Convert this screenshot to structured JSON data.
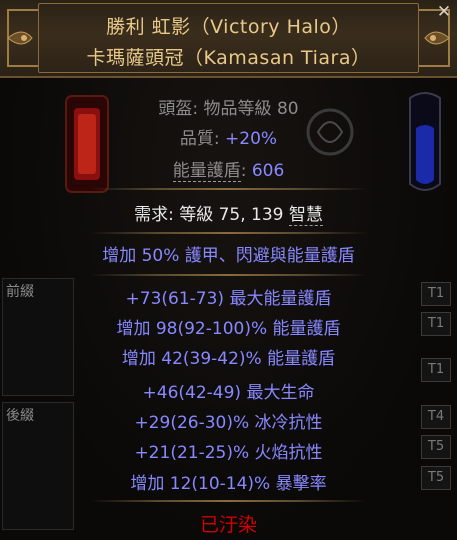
{
  "header": {
    "name": "勝利 虹影（Victory Halo）",
    "base_type": "卡瑪薩頭冠（Kamasan Tiara）"
  },
  "properties": {
    "type_line": "頭盔: 物品等級 80",
    "quality_label": "品質: ",
    "quality_value": "+20%",
    "es_label": "能量護盾",
    "es_colon": ": ",
    "es_value": "606"
  },
  "requirements": {
    "prefix": "需求: 等級 75, 139 ",
    "stat": "智慧"
  },
  "implicit": "增加 50% 護甲、閃避與能量護盾",
  "section_labels": {
    "prefix": "前綴",
    "suffix": "後綴"
  },
  "mods": [
    {
      "text": "+73(61-73) 最大能量護盾",
      "tier": "T1"
    },
    {
      "text": "增加 98(92-100)% 能量護盾",
      "tier": "T1"
    },
    {
      "text": "增加 42(39-42)% 能量護盾",
      "tier": "T1"
    },
    {
      "text": "+46(42-49) 最大生命",
      "tier": ""
    },
    {
      "text": "+29(26-30)% 冰冷抗性",
      "tier": "T4"
    },
    {
      "text": "+21(21-25)% 火焰抗性",
      "tier": "T5"
    },
    {
      "text": "增加 12(10-14)% 暴擊率",
      "tier": "T5"
    }
  ],
  "status": "已汙染",
  "close_symbol": "✕",
  "colors": {
    "title": "#e8c98a",
    "magic_blue": "#8888ff",
    "corrupted": "#d20000",
    "property_gray": "#8c8c8c"
  }
}
